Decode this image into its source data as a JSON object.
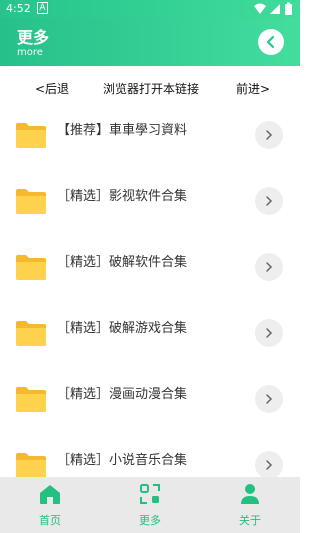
{
  "status_bar": {
    "time": "4:52",
    "badge": "A"
  },
  "header": {
    "title": "更多",
    "subtitle": "more"
  },
  "nav": {
    "back": "<后退",
    "open_browser": "浏览器打开本链接",
    "forward": "前进>"
  },
  "items": [
    {
      "label": "【推荐】車車學习資料"
    },
    {
      "label": "［精选］影视软件合集"
    },
    {
      "label": "［精选］破解软件合集"
    },
    {
      "label": "［精选］破解游戏合集"
    },
    {
      "label": "［精选］漫画动漫合集"
    },
    {
      "label": "［精选］小说音乐合集"
    }
  ],
  "tabs": [
    {
      "label": "首页",
      "icon": "home-icon"
    },
    {
      "label": "更多",
      "icon": "grid-icon"
    },
    {
      "label": "关于",
      "icon": "person-icon"
    }
  ],
  "colors": {
    "accent": "#22c081",
    "folder": "#ffd24d",
    "tab_bg": "#e9e9e9"
  }
}
